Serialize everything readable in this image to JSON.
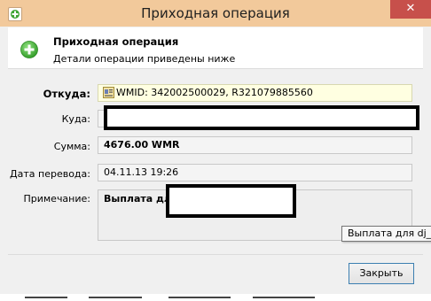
{
  "window": {
    "title": "Приходная операция",
    "close_glyph": "✕"
  },
  "header": {
    "title": "Приходная операция",
    "subtitle": "Детали операции приведены ниже",
    "icon": "plus-circle-icon"
  },
  "fields": {
    "from": {
      "label": "Откуда:",
      "value": "WMID: 342002500029, R321079885560"
    },
    "to": {
      "label": "Куда:",
      "value": ""
    },
    "amount": {
      "label": "Сумма:",
      "value": "4676.00 WMR"
    },
    "date": {
      "label": "Дата перевода:",
      "value": "04.11.13 19:26"
    },
    "note": {
      "label": "Примечание:",
      "value": "Выплата для"
    }
  },
  "tooltip": {
    "text": "Выплата для dj_k"
  },
  "buttons": {
    "close_label": "Закрыть"
  },
  "colors": {
    "titlebar": "#f2c99b",
    "close_button": "#c7504b",
    "accent_green": "#3fa535"
  }
}
